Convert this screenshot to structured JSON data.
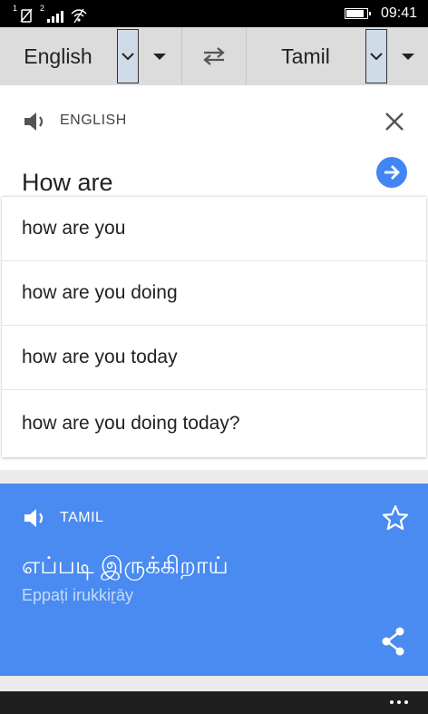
{
  "status_bar": {
    "sim1": "1",
    "sim2": "2",
    "time": "09:41",
    "battery_level": 0.9
  },
  "language_bar": {
    "source_language": "English",
    "target_language": "Tamil",
    "swap_icon": "swap-arrows-icon",
    "dropdown_icon": "caret-down-icon"
  },
  "input_card": {
    "language_label": "ENGLISH",
    "text": "How are",
    "speaker_icon": "speaker-icon",
    "close_icon": "close-icon",
    "go_icon": "arrow-right-circle-icon"
  },
  "suggestions": [
    "how are you",
    "how are you doing",
    "how are you today",
    "how are you doing today?"
  ],
  "result_card": {
    "language_label": "TAMIL",
    "translation": "எப்படி இருக்கிறாய்",
    "transliteration": "Eppaṭi irukkiṟāy",
    "star_icon": "star-outline-icon",
    "share_icon": "share-icon"
  },
  "app_bar": {
    "more_icon": "more-dots-icon"
  },
  "colors": {
    "accent_blue": "#4a8bf1",
    "go_button": "#4285f4",
    "lang_bar_bg": "#dcdcdc"
  }
}
